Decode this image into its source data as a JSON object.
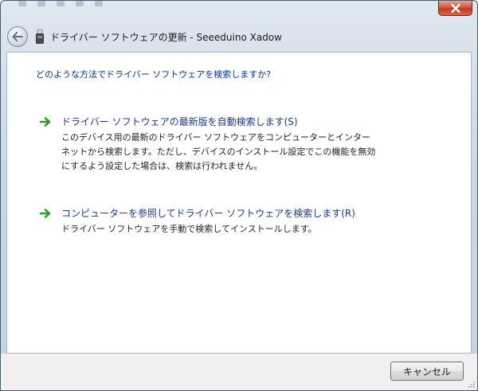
{
  "window": {
    "title": "ドライバー ソフトウェアの更新 - Seeeduino Xadow"
  },
  "icons": {
    "back": "back-arrow-icon",
    "device": "usb-device-icon",
    "close": "close-icon",
    "option_arrow": "green-arrow-icon"
  },
  "colors": {
    "question_text": "#0033a0",
    "option_title": "#1c3a8c",
    "option_arrow": "#2e9d2e",
    "close_button": "#c23a1f"
  },
  "main": {
    "question": "どのような方法でドライバー ソフトウェアを検索しますか?",
    "options": [
      {
        "title": "ドライバー ソフトウェアの最新版を自動検索します(S)",
        "desc_lines": [
          "このデバイス用の最新のドライバー ソフトウェアをコンピューターとインター",
          "ネットから検索します。ただし、デバイスのインストール設定でこの機能を無効",
          "にするよう設定した場合は、検索は行われません。"
        ]
      },
      {
        "title": "コンピューターを参照してドライバー ソフトウェアを検索します(R)",
        "desc_lines": [
          "ドライバー ソフトウェアを手動で検索してインストールします。"
        ]
      }
    ]
  },
  "footer": {
    "cancel_label": "キャンセル"
  }
}
